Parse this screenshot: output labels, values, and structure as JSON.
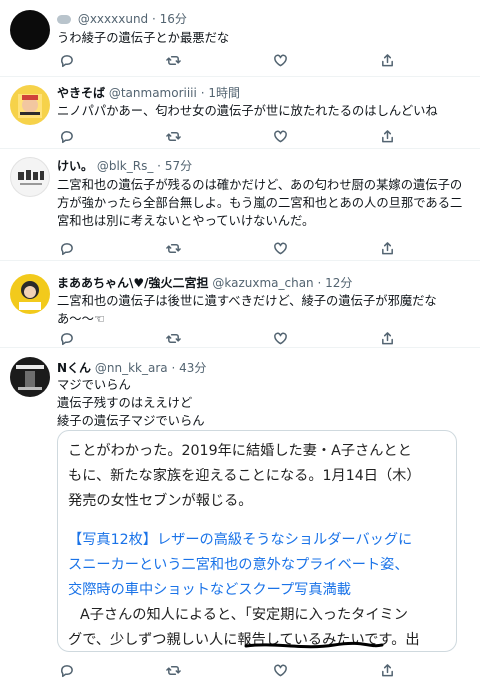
{
  "tweets": [
    {
      "handle": "@xxxxxund",
      "dot": "·",
      "time": "16分",
      "text": "うわ綾子の遺伝子とか最悪だな"
    },
    {
      "name": "やきそば",
      "handle": "@tanmamoriiii",
      "dot": "·",
      "time": "1時間",
      "text": "ニノパパかあー、匂わせ女の遺伝子が世に放たれたるのはしんどいね"
    },
    {
      "name": "けい。",
      "handle": "@blk_Rs_",
      "dot": "·",
      "time": "57分",
      "text": "二宮和也の遺伝子が残るのは確かだけど、あの匂わせ厨の某嫁の遺伝子の方が強かったら全部台無しよ。もう嵐の二宮和也とあの人の旦那である二宮和也は別に考えないとやっていけないんだ。"
    },
    {
      "name": "まああちゃん\\♥/強火二宮担",
      "handle": "@kazuxma_chan",
      "dot": "·",
      "time": "12分",
      "text": "二宮和也の遺伝子は後世に遺すべきだけど、綾子の遺伝子が邪魔だなあ〜〜☜"
    },
    {
      "name": "Nくん",
      "handle": "@nn_kk_ara",
      "dot": "·",
      "time": "43分",
      "line1": "マジでいらん",
      "line2": "遺伝子残すのはええけど",
      "line3": "綾子の遺伝子マジでいらん"
    }
  ],
  "embed": {
    "para1_l1": "ことがわかった。2019年に結婚した妻・A子さんとと",
    "para1_l2": "もに、新たな家族を迎えることになる。1月14日（木）",
    "para1_l3": "発売の女性セブンが報じる。",
    "link_l1": "【写真12枚】レザーの高級そうなショルダーバッグに",
    "link_l2": "スニーカーという二宮和也の意外なプライベート姿、",
    "link_l3": "交際時の車中ショットなどスクープ写真満載",
    "para2_l1": "A子さんの知人によると、「安定期に入ったタイミン",
    "para2_l2": "グで、少しずつ親しい人に報告しているみたいです。出"
  },
  "icons": {
    "reply": "reply-icon",
    "retweet": "retweet-icon",
    "like": "heart-icon",
    "share": "share-icon"
  },
  "colors": {
    "link": "#1a73e8",
    "secondary_text": "#536471",
    "divider": "#eff3f4"
  }
}
